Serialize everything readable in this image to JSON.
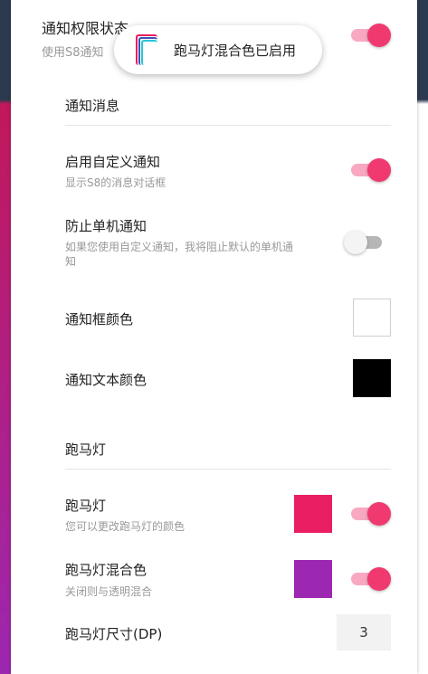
{
  "top_item": {
    "title": "通知权限状态",
    "subtitle": "使用S8通知",
    "enabled": true
  },
  "toast": {
    "text": "跑马灯混合色已启用",
    "icon": "marquee-layers-icon"
  },
  "sections": {
    "notifications": {
      "header": "通知消息",
      "custom_notification": {
        "title": "启用自定义通知",
        "subtitle": "显示S8的消息对话框",
        "enabled": true
      },
      "block_stock": {
        "title": "防止单机通知",
        "subtitle_line1": "如果您使用自定义通知，我将阻止默认的单机通",
        "subtitle_line2": "知",
        "enabled": false
      },
      "box_color": {
        "title": "通知框颜色",
        "color": "#ffffff"
      },
      "text_color": {
        "title": "通知文本颜色",
        "color": "#000000"
      }
    },
    "marquee": {
      "header": "跑马灯",
      "marquee": {
        "title": "跑马灯",
        "subtitle": "您可以更改跑马灯的颜色",
        "color": "#e91e63",
        "enabled": true
      },
      "blend": {
        "title": "跑马灯混合色",
        "subtitle": "关闭则与透明混合",
        "color": "#9c27b0",
        "enabled": true
      },
      "size": {
        "title": "跑马灯尺寸(DP)",
        "value": "3"
      }
    }
  },
  "colors": {
    "accent": "#f0396f",
    "accent_track": "#f8a9c1",
    "header_dark": "#2b3a4f"
  }
}
